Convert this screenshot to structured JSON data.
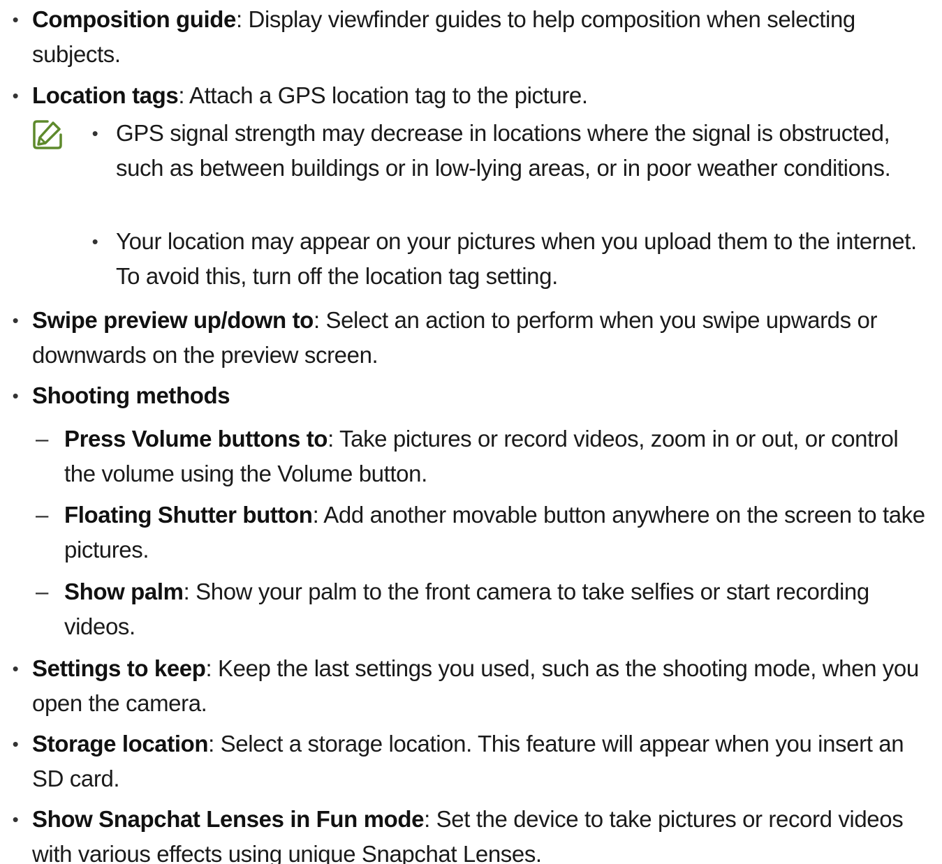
{
  "items": [
    {
      "term": "Composition guide",
      "desc": ": Display viewfinder guides to help composition when selecting subjects."
    },
    {
      "term": "Location tags",
      "desc": ": Attach a GPS location tag to the picture."
    },
    {
      "note_1": "GPS signal strength may decrease in locations where the signal is obstructed, such as between buildings or in low-lying areas, or in poor weather conditions."
    },
    {
      "note_2": "Your location may appear on your pictures when you upload them to the internet. To avoid this, turn off the location tag setting."
    },
    {
      "term": "Swipe preview up/down to",
      "desc": ": Select an action to perform when you swipe upwards or downwards on the preview screen."
    },
    {
      "term": "Shooting methods"
    },
    {
      "term": "Press Volume buttons to",
      "desc": ": Take pictures or record videos, zoom in or out, or control the volume using the Volume button."
    },
    {
      "term": "Floating Shutter button",
      "desc": ": Add another movable button anywhere on the screen to take pictures."
    },
    {
      "term": "Show palm",
      "desc": ": Show your palm to the front camera to take selfies or start recording videos."
    },
    {
      "term": "Settings to keep",
      "desc": ": Keep the last settings you used, such as the shooting mode, when you open the camera."
    },
    {
      "term": "Storage location",
      "desc": ": Select a storage location. This feature will appear when you insert an SD card."
    },
    {
      "term": "Show Snapchat Lenses in Fun mode",
      "desc": ": Set the device to take pictures or record videos with various effects using unique Snapchat Lenses."
    }
  ],
  "bullet_glyph": "•",
  "dash_glyph": "–",
  "colors": {
    "text": "#1a1a1a",
    "note_icon": "#5e8a2c"
  },
  "icons": {
    "note": "note-pencil-icon"
  }
}
